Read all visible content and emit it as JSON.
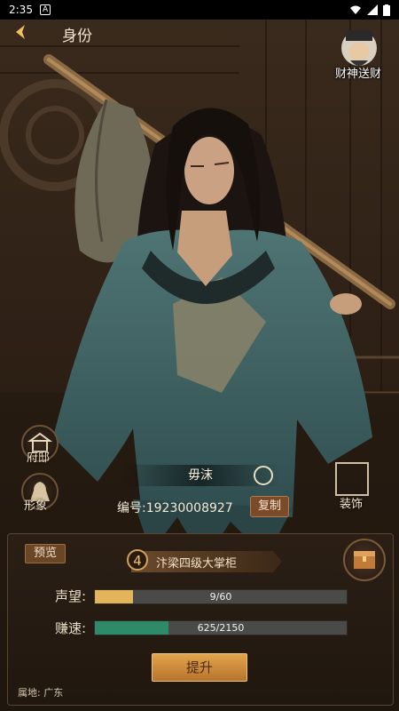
{
  "status_bar": {
    "time": "2:35",
    "notif": "A"
  },
  "header": {
    "title": "身份"
  },
  "god_button": {
    "label": "财神送财"
  },
  "side_buttons": {
    "left_top": "府邸",
    "left_bottom": "形象",
    "right": "装饰"
  },
  "character": {
    "name": "毋沫",
    "id_text": "编号:19230008927",
    "copy_label": "复制"
  },
  "panel": {
    "preview_label": "预览",
    "rank_level": "4",
    "rank_title": "汴梁四级大掌柜",
    "stats": [
      {
        "label": "声望:",
        "value_text": "9/60",
        "current": 9,
        "max": 60
      },
      {
        "label": "赚速:",
        "value_text": "625/2150",
        "current": 625,
        "max": 2150
      }
    ],
    "upgrade_label": "提升",
    "location": "属地: 广东"
  },
  "colors": {
    "reputation_fill": "#e3b45a",
    "speed_fill": "#2f8a6a",
    "accent": "#d2a25a"
  }
}
